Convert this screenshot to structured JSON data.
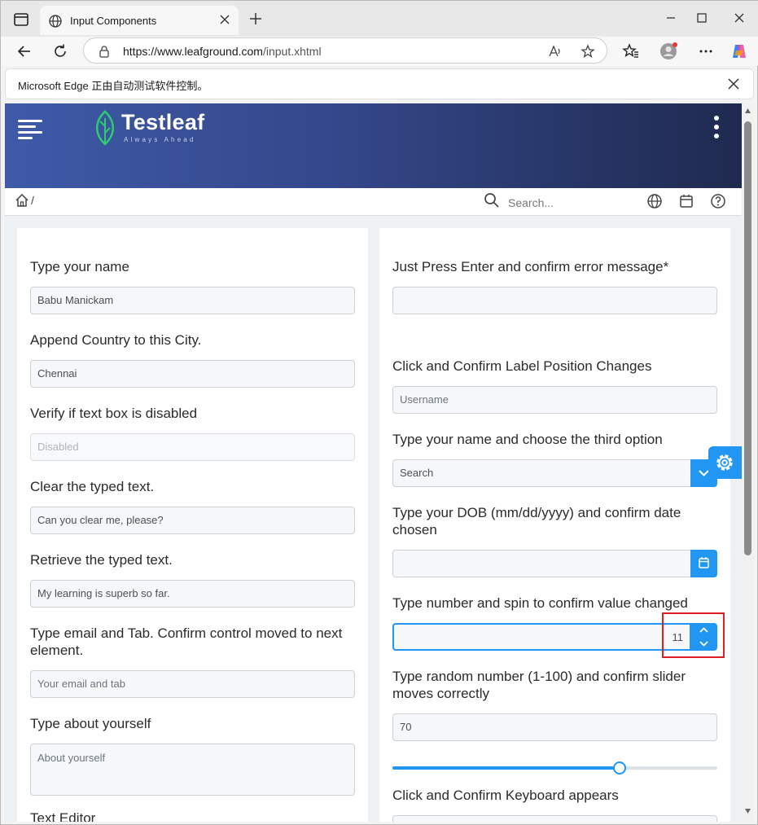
{
  "browser": {
    "tab_title": "Input Components",
    "url_host": "https://www.leafground.com",
    "url_path": "/input.xhtml",
    "infobar_message": "Microsoft Edge 正由自动测试软件控制。"
  },
  "site": {
    "logo_name": "Testleaf",
    "logo_tagline": "Always Ahead",
    "breadcrumb_separator": "/",
    "search_placeholder": "Search..."
  },
  "left_card": {
    "fields": [
      {
        "label": "Type your name",
        "value": "Babu Manickam"
      },
      {
        "label": "Append Country to this City.",
        "value": "Chennai"
      },
      {
        "label": "Verify if text box is disabled",
        "value": "Disabled"
      },
      {
        "label": "Clear the typed text.",
        "value": "Can you clear me, please?"
      },
      {
        "label": "Retrieve the typed text.",
        "value": "My learning is superb so far."
      },
      {
        "label": "Type email and Tab. Confirm control moved to next element.",
        "placeholder": "Your email and tab"
      },
      {
        "label": "Type about yourself",
        "placeholder": "About yourself"
      },
      {
        "label": "Text Editor"
      }
    ]
  },
  "right_card": {
    "fields": [
      {
        "label": "Just Press Enter and confirm error message*",
        "value": ""
      },
      {
        "label": "Click and Confirm Label Position Changes",
        "placeholder": "Username"
      },
      {
        "label": "Type your name and choose the third option",
        "placeholder": "Search"
      },
      {
        "label": "Type your DOB (mm/dd/yyyy) and confirm date chosen",
        "value": ""
      },
      {
        "label": "Type number and spin to confirm value changed",
        "value": "11"
      },
      {
        "label": "Type random number (1-100) and confirm slider moves correctly",
        "value": "70"
      },
      {
        "label": "Click and Confirm Keyboard appears"
      }
    ],
    "slider_percent": 70
  },
  "colors": {
    "accent": "#2196f3",
    "header_start": "#3e5aa8",
    "header_end": "#1f2a4f",
    "highlight": "#e02020"
  }
}
